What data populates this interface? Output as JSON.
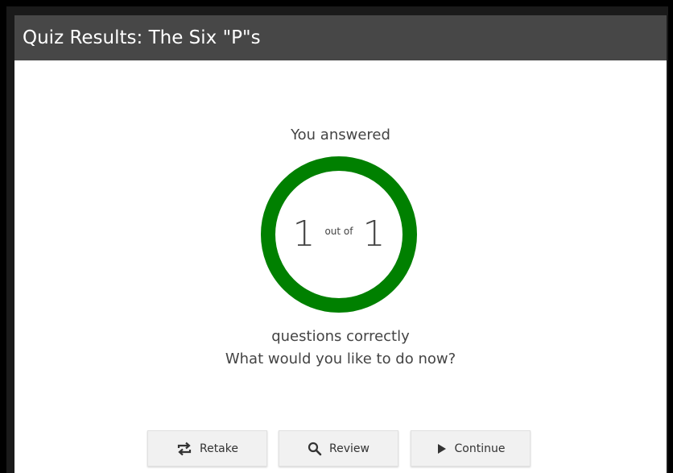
{
  "header": {
    "title": "Quiz Results: The Six \"P\"s"
  },
  "results": {
    "intro": "You answered",
    "correct": "1",
    "separator": "out of",
    "total": "1",
    "outro": "questions correctly",
    "prompt": "What would you like to do now?",
    "ring_color": "#008000",
    "score_fraction": 1.0
  },
  "actions": {
    "retake_label": "Retake",
    "retake_icon": "repeat-icon",
    "review_label": "Review",
    "review_icon": "search-icon",
    "continue_label": "Continue",
    "continue_icon": "play-icon"
  }
}
